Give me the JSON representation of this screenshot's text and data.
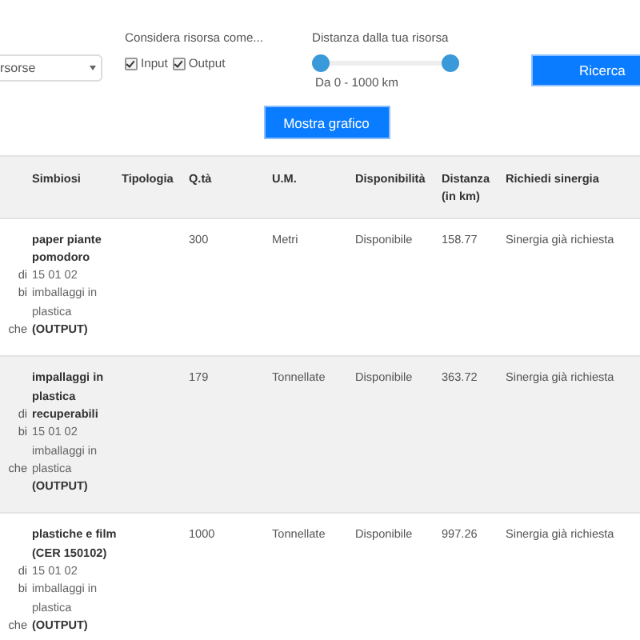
{
  "filters": {
    "resource_select": {
      "value": "rsorse"
    },
    "consider_as": {
      "label": "Considera risorsa come...",
      "options": [
        {
          "label": "Input",
          "checked": true
        },
        {
          "label": "Output",
          "checked": true
        }
      ]
    },
    "distance": {
      "label": "Distanza dalla tua risorsa",
      "thumbs": [
        {
          "level": 0
        },
        {
          "level": 1
        }
      ],
      "reading": "Da 0 - 1000 km"
    },
    "search_button": "Ricerca",
    "chart_button": "Mostra grafico"
  },
  "table": {
    "columns": [
      "Simbiosi",
      "Tipologia",
      "Q.tà",
      "U.M.",
      "Disponibilità",
      "Distanza (in km)",
      "Richiedi sinergia"
    ],
    "rows": [
      {
        "column_1": [
          "di",
          "bi",
          "che"
        ],
        "name": "paper piante pomodoro",
        "detail": "15 01 02 imballaggi in plastica",
        "role": "(OUTPUT)",
        "quantity": "300",
        "unit": "Metri",
        "availability": "Disponibile",
        "distance": "158.77",
        "synergy": "Sinergia già richiesta"
      },
      {
        "column_1": [
          "di",
          "bi",
          "che"
        ],
        "name": "impallaggi in plastica recuperabili",
        "detail": "15 01 02 imballaggi in plastica",
        "role": "(OUTPUT)",
        "quantity": "179",
        "unit": "Tonnellate",
        "availability": "Disponibile",
        "distance": "363.72",
        "synergy": "Sinergia già richiesta"
      },
      {
        "column_1": [
          "di",
          "bi",
          "che"
        ],
        "name": "plastiche e film (CER 150102)",
        "detail": "15 01 02 imballaggi in plastica",
        "role": "(OUTPUT)",
        "quantity": "1000",
        "unit": "Tonnellate",
        "availability": "Disponibile",
        "distance": "997.26",
        "synergy": "Sinergia già richiesta"
      }
    ]
  }
}
